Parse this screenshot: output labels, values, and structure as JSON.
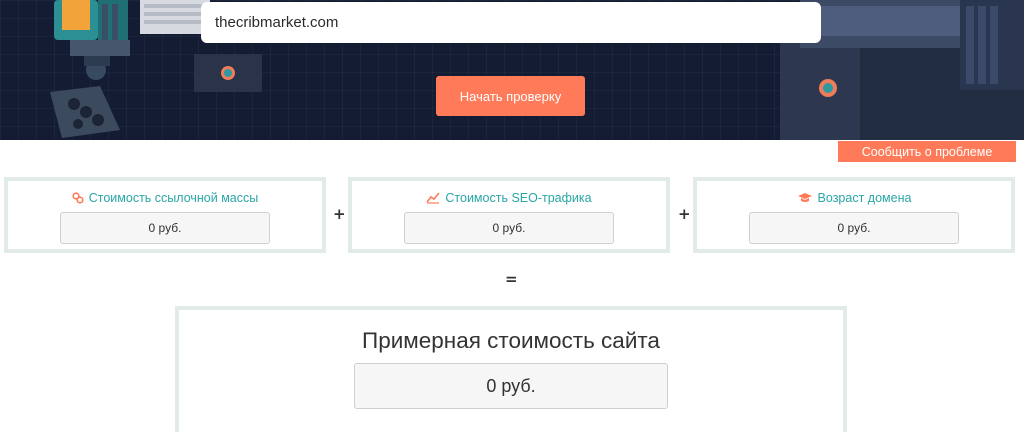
{
  "search": {
    "value": "thecribmarket.com"
  },
  "actions": {
    "start_label": "Начать проверку",
    "report_label": "Сообщить о проблеме"
  },
  "metrics": [
    {
      "title": "Стоимость ссылочной массы",
      "icon": "link-icon",
      "value": "0 руб."
    },
    {
      "title": "Стоимость SEO-трафика",
      "icon": "chart-line-icon",
      "value": "0 руб."
    },
    {
      "title": "Возраст домена",
      "icon": "graduation-cap-icon",
      "value": "0 руб."
    }
  ],
  "operators": {
    "plus": "+",
    "equals": "="
  },
  "result": {
    "title": "Примерная стоимость сайта",
    "value": "0 руб."
  },
  "colors": {
    "accent": "#ff7a59",
    "teal": "#2aa6a6",
    "hero_bg": "#141c33",
    "card_border": "#e3ebe8"
  }
}
